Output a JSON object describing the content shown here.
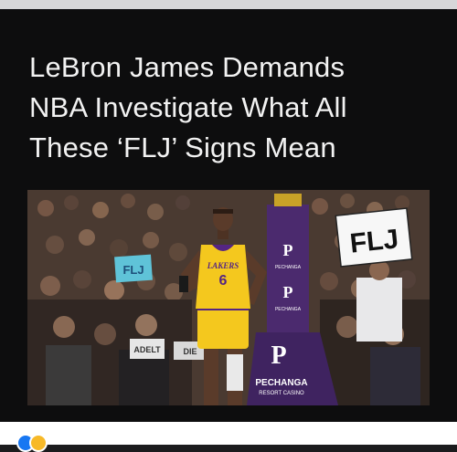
{
  "post": {
    "headline_lines": [
      "LeBron James Demands",
      "NBA Investigate What All",
      "These ‘FLJ’ Signs Mean"
    ],
    "photo": {
      "jersey_team": "LAKERS",
      "jersey_number": "6",
      "fan_sign": "FLJ",
      "fan_sign_left": "FLJ",
      "sponsor_name": "PECHANGA",
      "sponsor_sub": "RESORT CASINO",
      "court_sign_left": "ADELT",
      "court_sign_right": "DIE"
    }
  },
  "footer": {
    "reactions_icon": "like-haha-reaction-icons",
    "reactions_count": "",
    "comments": "",
    "shares": ""
  },
  "colors": {
    "card_bg": "#0d0d0e",
    "headline": "#f2f2f2",
    "lakers_gold": "#f4c81e",
    "lakers_purple": "#552583",
    "like_blue": "#1877f2"
  }
}
